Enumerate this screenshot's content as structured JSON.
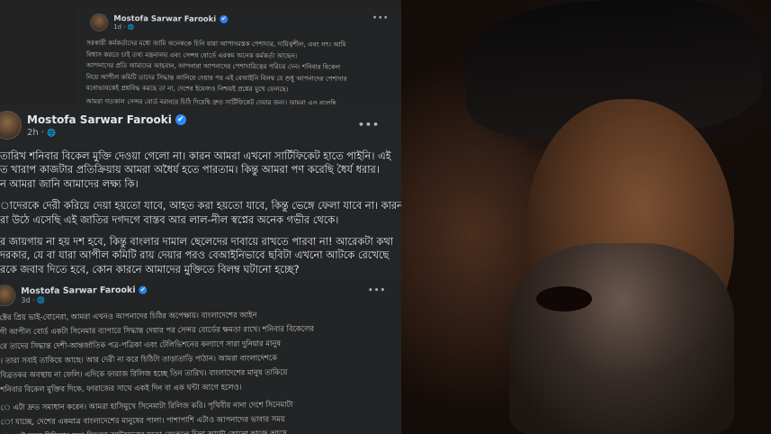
{
  "posts": [
    {
      "author": "Mostofa Sarwar Farooki",
      "time": "1d · ",
      "paragraphs": [
        "সরকারী কর্মকর্তাদের মধ্যে আমি অনেককে চিনি যারা আপাদমস্তক পেশাদার, দায়িত্বশীল, এবং সৎ। আমি",
        "বিশ্বাস করতে চাই তথ্য মন্ত্রনালয় এবং সেন্সর বোর্ডে এরকম অনেক কর্মকর্তা আছেন।",
        "আপনাদের প্রতি আমাদের আহবান, আপনারা আপনাদের পেশাদারিত্বের পরিচয় দেন। শনিবার বিকেল",
        "নিয়ে আপীল কমিটি তাদের সিদ্ধান্ত জানিয়ে দেয়ার পর এই বেআইনি বিলম্ব যে শুধু আপনাদের পেশাদার",
        "মনোভাবকেই প্রশ্নবিদ্ধ করছে তা না, দেশের ইমেজও নিশ্চয়ই প্রশ্নের মুখে ফেলছে।",
        "আমরা গতকাল সেন্সর বোর্ড বরাবরে চিঠি দিয়েছি দ্রুত সার্টিফিকেট দেয়ার জন্য। আমরা এও বলেছি"
      ]
    },
    {
      "author": "Mostofa Sarwar Farooki",
      "time": "2h · ",
      "paragraphs": [
        "তারিখ শনিবার বিকেল মুক্তি দেওয়া গেলো না। কারন আমরা এখনো সার্টিফিকেট হাতে পাইনি। এই",
        "ত খারাপ কাজটার প্রতিক্রিয়ায় আমরা অধৈর্য হতে পারতাম। কিন্তু আমরা পণ করেছি ধৈর্য ধরার।",
        "ন আমরা জানি আমাদের লক্ষ্য কি।",
        "াদেরকে দেরী করিয়ে দেয়া হয়তো যাবে, আহত করা হয়তো যাবে, কিন্তু ভেঙ্গে ফেলা যাবে না। কারন",
        "রা উঠে এসেছি এই জাতির দগদগে বাস্তব আর লাল-নীল স্বপ্নের অনেক গভীর থেকে।",
        "র জায়গায় না হয় দশ হবে, কিন্তু বাংলার দামাল ছেলেদের দাবায়ে রাখতে পারবা না! আরেকটা কথা",
        " দরকার, যে বা যারা আপীল কমিটি রায় দেয়ার পরও বেআইনিভাবে ছবিটা এখনো আটকে রেখেছে",
        "রকে জবাব দিতে হবে, কোন কারনে আমাদের মুক্তিতে বিলম্ব ঘটানো হচ্ছে?"
      ]
    },
    {
      "author": "Mostofa Sarwar Farooki",
      "time": "3d · ",
      "paragraphs": [
        "ক্টের প্রিয় ভাই-বোনেরা, আমরা এখনও আপনাদের চিঠির অপেক্ষায়। বাংলাদেশের আইন",
        "গী আপীল বোর্ড একটা সিনেমার ব্যাপারে সিদ্ধান্ত দেয়ার পর সেন্সর বোর্ডের ক্ষমতা রাখে। শনিবার বিকেলের",
        "রে তাদের সিদ্ধান্ত দেশী-আন্তর্জাতিক পত্র-পত্রিকা এবং টেলিভিশনের কল্যাণে সারা দুনিয়ার মানুষ",
        "। তারা সবাই তাকিয়ে আছে। আর দেরী না করে চিঠিটা তাড়াতাড়ি পাঠান। আমরা বাংলাদেশকে",
        "বিব্রতকর অবস্থায় না ফেলি। এদিকে ফারাজ রিলিজ হচ্ছে তিন তারিখ। বাংলাদেশের মানুষ তাকিয়ে",
        "শনিবার বিকেল মুক্তির দিকে, ফারাজের সাথে একই দিন বা এক ঘন্টা আগে হলেও।",
        "ে এটা দ্রুত সমাধান করেন। আমরা হাসিমুখে সিনেমাটা রিলিজ করি। পৃথিবীর নানা দেশে সিনেমাটা",
        "ো যাচ্ছে, দেশের একমাত্র বাংলাদেশের মানুষের পালা। পাশাপাশি এটাও আপনাদের ভাবার সময়",
        "ে, এই নতুন মিডিয়ার যুগে সিনেমা আটকানোর মতো সেকেলে চিন্তা আদৌ কোনো কাজে আসে"
      ]
    }
  ],
  "ui": {
    "more_icon": "•••",
    "globe_icon": "🌐",
    "verified_icon": "✔"
  }
}
